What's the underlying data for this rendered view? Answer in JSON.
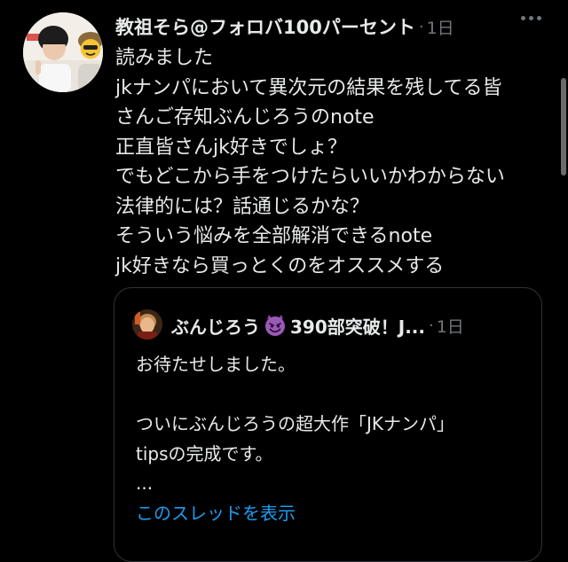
{
  "tweet": {
    "author_name": "教祖そら@フォロバ100パーセント",
    "dot": "·",
    "time": "1日",
    "body_lines": [
      "読みました",
      "jkナンパにおいて異次元の結果を残してる皆",
      "さんご存知ぶんじろうのnote",
      "正直皆さんjk好きでしょ？",
      "でもどこから手をつけたらいいかわからない",
      "法律的には？話通じるかな？",
      "そういう悩みを全部解消できるnote",
      "jk好きなら買っとくのをオススメする"
    ]
  },
  "quote": {
    "author_name": "ぶんじろう",
    "author_suffix": "390部突破！J...",
    "dot": "·",
    "time": "1日",
    "body_lines": [
      "お待たせしました。",
      "",
      "ついにぶんじろうの超大作「JKナンパ」",
      "tipsの完成です。",
      "..."
    ],
    "show_thread": "このスレッドを表示"
  },
  "colors": {
    "background": "#000000",
    "text": "#e7e9ea",
    "secondary": "#71767b",
    "link": "#1d9bf0",
    "border": "#2f3336"
  },
  "icons": {
    "emoji": "smiling-devil-emoji",
    "more": "more-dots-icon"
  }
}
